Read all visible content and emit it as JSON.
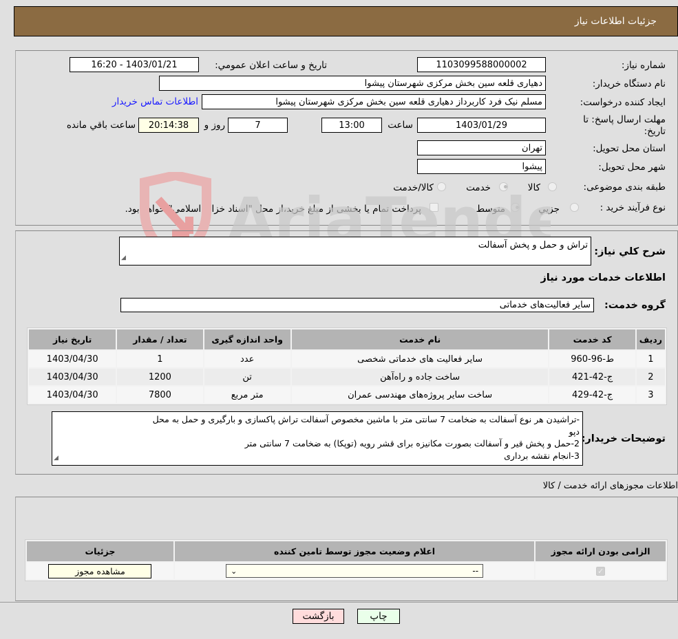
{
  "header": {
    "title": "جزئیات اطلاعات نیاز"
  },
  "form": {
    "need_number_label": "شماره نیاز:",
    "need_number": "1103099588000002",
    "announce_label": "تاریخ و ساعت اعلان عمومي:",
    "announce_value": "1403/01/21 - 16:20",
    "buyer_org_label": "نام دستگاه خریدار:",
    "buyer_org": "دهیاری قلعه سین بخش مرکزی شهرستان پیشوا",
    "creator_label": "ایجاد کننده درخواست:",
    "creator": "مسلم نیک فرد کاربرداز دهیاری قلعه سین بخش مرکزی شهرستان پیشوا",
    "contact_link": "اطلاعات تماس خریدار",
    "deadline_label_1": "مهلت ارسال پاسخ: تا",
    "deadline_label_2": "تاریخ:",
    "deadline_date": "1403/01/29",
    "time_label": "ساعت",
    "deadline_time": "13:00",
    "days": "7",
    "days_label": "روز و",
    "remaining": "20:14:38",
    "remaining_label": "ساعت باقي مانده",
    "province_label": "استان محل تحویل:",
    "province": "تهران",
    "city_label": "شهر محل تحویل:",
    "city": "پیشوا",
    "category_label": "طبقه بندی موضوعی:",
    "category_options": [
      {
        "label": "کالا",
        "checked": false
      },
      {
        "label": "خدمت",
        "checked": true
      },
      {
        "label": "کالا/خدمت",
        "checked": false
      }
    ],
    "process_label": "نوع فرآیند خرید :",
    "process_options": [
      {
        "label": "جزيي",
        "checked": false
      },
      {
        "label": "متوسط",
        "checked": true
      }
    ],
    "treasury_text": "پرداخت تمام یا بخشی از مبلغ خرید،از محل \"اسناد خزانه اسلامی\" خواهد بود.",
    "treasury_checked": false
  },
  "details": {
    "summary_label": "شرح کلي نیاز:",
    "summary": "تراش و حمل و پخش آسفالت",
    "services_heading": "اطلاعات خدمات مورد نیاز",
    "service_group_label": "گروه خدمت:",
    "service_group": "سایر فعالیت‌های خدماتی",
    "table": {
      "headers": [
        "ردیف",
        "کد خدمت",
        "نام خدمت",
        "واحد اندازه گیری",
        "تعداد / مقدار",
        "تاریخ نیاز"
      ],
      "rows": [
        [
          "1",
          "ط-96-960",
          "سایر فعالیت های خدماتی شخصی",
          "عدد",
          "1",
          "1403/04/30"
        ],
        [
          "2",
          "ج-42-421",
          "ساخت جاده و راه‌آهن",
          "تن",
          "1200",
          "1403/04/30"
        ],
        [
          "3",
          "ج-42-429",
          "ساخت سایر پروژه‌های مهندسی عمران",
          "متر مربع",
          "7800",
          "1403/04/30"
        ]
      ]
    },
    "buyer_notes_label": "توضیحات خریدار:",
    "buyer_notes": [
      "-تراشیدن هر نوع آسفالت  به ضخامت 7 سانتی متر با ماشین مخصوص آسفالت تراش پاکسازی و بارگیری و حمل به محل",
      "دپو",
      "2-حمل و پخش قیر و آسفالت  بصورت مکانیزه برای قشر رویه (توپکا) به ضخامت 7 سانتی متر",
      "3-انجام نقشه برداری"
    ]
  },
  "permits": {
    "heading": "اطلاعات مجوزهای ارائه خدمت / کالا",
    "headers": [
      "الزامی بودن ارائه مجوز",
      "اعلام وضعیت مجوز توسط تامین کننده",
      "جزئیات"
    ],
    "row": {
      "required_checked": true,
      "status_value": "--",
      "view_button": "مشاهده مجوز"
    }
  },
  "actions": {
    "print": "چاپ",
    "back": "بازگشت"
  },
  "watermark": "AriaTender.neT",
  "colors": {
    "header_bg": "#8b6b42",
    "print_bg": "#eaffea",
    "back_bg": "#ffdcdc",
    "link": "#1a1aff"
  }
}
